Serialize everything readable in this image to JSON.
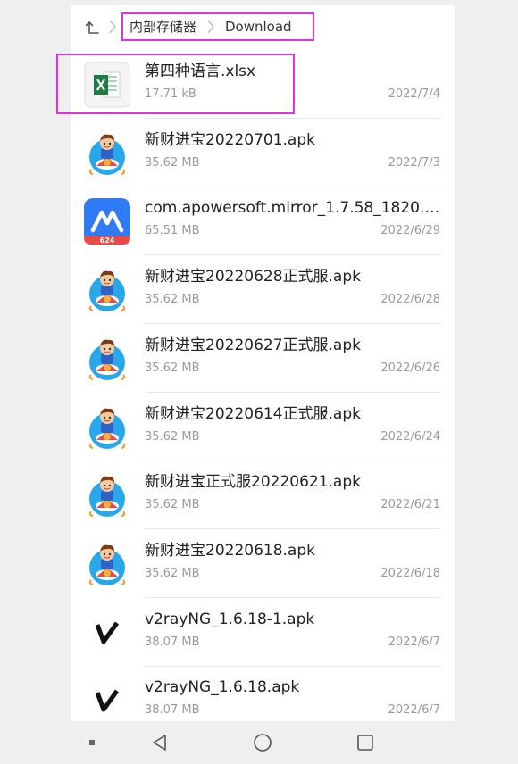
{
  "breadcrumb": {
    "root": "内部存储器",
    "current": "Download"
  },
  "files": [
    {
      "name": "第四种语言.xlsx",
      "size": "17.71 kB",
      "date": "2022/7/4",
      "icon": "excel-icon",
      "highlighted": true
    },
    {
      "name": "新财进宝20220701.apk",
      "size": "35.62 MB",
      "date": "2022/7/3",
      "icon": "rocket-boy-icon"
    },
    {
      "name": "com.apowersoft.mirror_1.7.58_1820.a..",
      "size": "65.51 MB",
      "date": "2022/6/29",
      "icon": "apowermirror-icon"
    },
    {
      "name": "新财进宝20220628正式服.apk",
      "size": "35.62 MB",
      "date": "2022/6/28",
      "icon": "rocket-boy-icon"
    },
    {
      "name": "新财进宝20220627正式服.apk",
      "size": "35.62 MB",
      "date": "2022/6/26",
      "icon": "rocket-boy-icon"
    },
    {
      "name": "新财进宝20220614正式服.apk",
      "size": "35.62 MB",
      "date": "2022/6/24",
      "icon": "rocket-boy-icon"
    },
    {
      "name": "新财进宝正式服20220621.apk",
      "size": "35.62 MB",
      "date": "2022/6/21",
      "icon": "rocket-boy-icon"
    },
    {
      "name": "新财进宝20220618.apk",
      "size": "35.62 MB",
      "date": "2022/6/18",
      "icon": "rocket-boy-icon"
    },
    {
      "name": "v2rayNG_1.6.18-1.apk",
      "size": "38.07 MB",
      "date": "2022/6/7",
      "icon": "v2rayng-icon"
    },
    {
      "name": "v2rayNG_1.6.18.apk",
      "size": "38.07 MB",
      "date": "2022/6/7",
      "icon": "v2rayng-icon"
    }
  ],
  "apowermirror_badge": "624",
  "colors": {
    "highlight": "#e030e0",
    "excel_green": "#1f7a45",
    "mirror_blue": "#2f7af5",
    "mirror_red": "#e84a4a",
    "rocket_bg": "#2aa7e8"
  },
  "navbar": {
    "icons": [
      "menu-square-icon",
      "back-triangle-icon",
      "home-circle-icon",
      "recents-square-icon"
    ]
  }
}
